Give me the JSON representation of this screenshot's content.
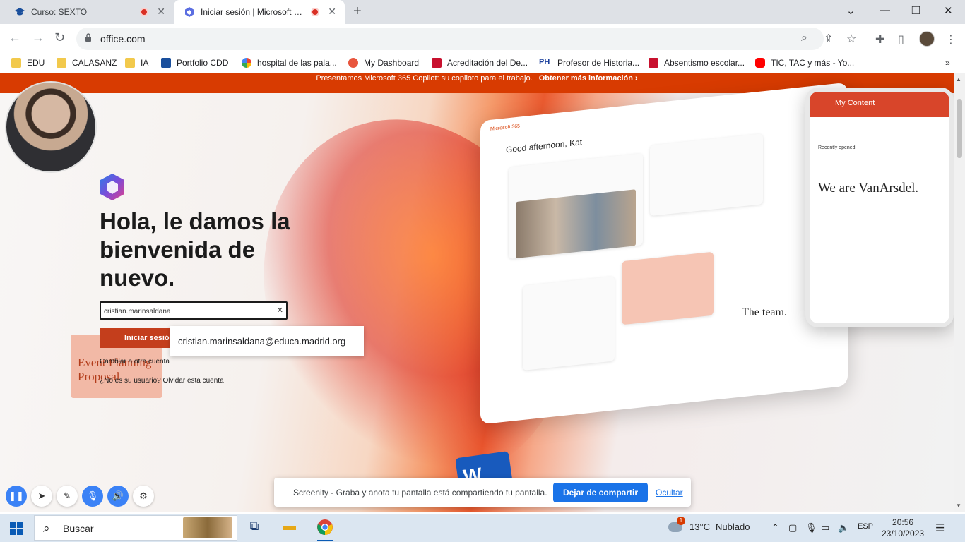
{
  "browser": {
    "tabs": [
      {
        "title": "Curso: SEXTO",
        "icon": "graduation-cap-icon"
      },
      {
        "title": "Iniciar sesión | Microsoft 365",
        "icon": "microsoft-365-icon"
      }
    ],
    "url": "office.com",
    "bookmarks": [
      {
        "label": "EDU",
        "icon": "folder-icon"
      },
      {
        "label": "CALASANZ",
        "icon": "folder-icon"
      },
      {
        "label": "IA",
        "icon": "folder-icon"
      },
      {
        "label": "Portfolio CDD",
        "icon": "graduation-cap-icon"
      },
      {
        "label": "hospital de las pala...",
        "icon": "google-icon"
      },
      {
        "label": "My Dashboard",
        "icon": "dashboard-icon"
      },
      {
        "label": "Acreditación del De...",
        "icon": "madrid-icon"
      },
      {
        "label": "Profesor de Historia...",
        "icon": "ph-icon"
      },
      {
        "label": "Absentismo escolar...",
        "icon": "madrid-icon"
      },
      {
        "label": "TIC, TAC y más - Yo...",
        "icon": "youtube-icon"
      }
    ]
  },
  "page": {
    "banner_text": "Presentamos Microsoft 365 Copilot: su copiloto para el trabajo.",
    "banner_link": "Obtener más información  ›",
    "headline": "Hola, le damos la bienvenida de nuevo.",
    "email_value": "cristian.marinsaldana",
    "signin_label": "Iniciar sesión",
    "autocomplete_suggestion": "cristian.marinsaldana@educa.madrid.org",
    "switch_account": "Cambiar a otra cuenta",
    "not_user": "¿No es su usuario? Olvidar esta cuenta"
  },
  "mockup": {
    "app_title": "Microsoft 365",
    "greeting": "Good afternoon, Kat",
    "phone_title": "My Content",
    "phone_recent": "Recently opened",
    "vanarsdel": "We are VanArsdel.",
    "team": "The team.",
    "planning": "Event Planning Proposal"
  },
  "screenity": {
    "share_text": "Screenity - Graba y anota tu pantalla está compartiendo tu pantalla.",
    "stop_label": "Dejar de compartir",
    "hide_label": "Ocultar"
  },
  "taskbar": {
    "search_label": "Buscar",
    "weather_temp": "13°C",
    "weather_desc": "Nublado",
    "weather_badge": "1",
    "language": "ESP",
    "time": "20:56",
    "date": "23/10/2023"
  },
  "colors": {
    "office_orange": "#d83b01",
    "signin_red": "#c43e1c",
    "chrome_blue": "#1a73e8"
  }
}
